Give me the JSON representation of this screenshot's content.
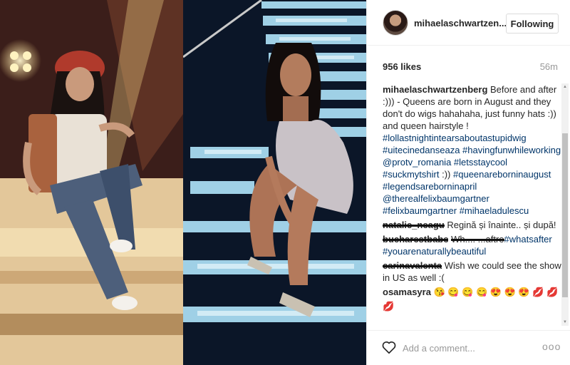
{
  "header": {
    "username": "mihaelaschwartzen...",
    "follow_label": "Following"
  },
  "stats": {
    "likes": "956 likes",
    "time": "56m"
  },
  "caption": {
    "username": "mihaelaschwartzenberg",
    "text": "Before and after :))) - Queens are born in August and they don't do wigs hahahaha, just funny hats :)) and queen hairstyle !",
    "tags": [
      "#lollastnightintearsaboutastupidwig",
      "#uitecinedanseaza",
      "#havingfunwhileworking",
      "@protv_romania",
      "#letsstaycool",
      "#suckmytshirt",
      ":))",
      "#queenareborninaugust",
      "#legendsareborninapril",
      "@therealfelixbaumgartner",
      "#felixbaumgartner",
      "#mihaeladulescu"
    ]
  },
  "comments": [
    {
      "username": "natalie_neagu",
      "text": "Regină și înainte.. și după!"
    },
    {
      "username": "bucharestbabe",
      "text": "Wh.... ...aftre",
      "tags": [
        "#whatsafter",
        "#youarenaturallybeautiful"
      ]
    },
    {
      "username": "carinavalenta",
      "text": "Wish we could see the show in US as well :("
    },
    {
      "username": "osamasyra",
      "text": "😘 😋 😋 😋 😍 😍 😍 💋 💋"
    },
    {
      "username": "",
      "text": "💋"
    }
  ],
  "footer": {
    "comment_placeholder": "Add a comment...",
    "more_label": "ooo"
  }
}
